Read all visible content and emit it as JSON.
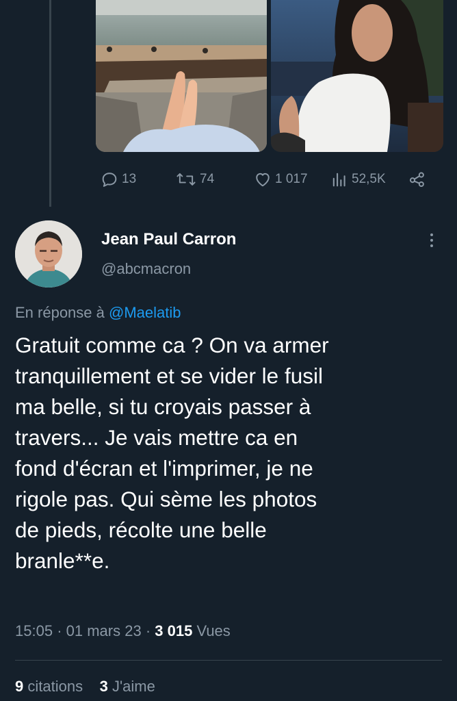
{
  "tweet_actions": {
    "replies": "13",
    "retweets": "74",
    "likes": "1 017",
    "views": "52,5K"
  },
  "author": {
    "display_name": "Jean Paul Carron",
    "handle": "@abcmacron"
  },
  "reply": {
    "prefix": "En réponse à",
    "mention": "@Maelatib"
  },
  "tweet": {
    "lines": [
      "Gratuit comme ca ? On va armer",
      "tranquillement et se vider le fusil",
      "ma belle, si tu croyais passer à",
      "travers... Je vais mettre ca en",
      "fond d'écran et l'imprimer, je ne",
      "rigole pas. Qui sème les photos",
      "de pieds, récolte une belle",
      "branle**e."
    ]
  },
  "meta": {
    "time": "15:05",
    "date": "01 mars 23",
    "views_count": "3 015",
    "views_label": "Vues"
  },
  "stats": {
    "citations_count": "9",
    "citations_label": "citations",
    "likes_count": "3",
    "likes_label": "J'aime"
  },
  "icons": {
    "reply": "reply-icon",
    "retweet": "retweet-icon",
    "like": "like-icon",
    "views": "views-icon",
    "share": "share-icon",
    "more": "more-icon"
  },
  "colors": {
    "background": "#15202b",
    "secondary_text": "#8b98a5",
    "link": "#1d9bf0",
    "divider": "#38444d"
  }
}
